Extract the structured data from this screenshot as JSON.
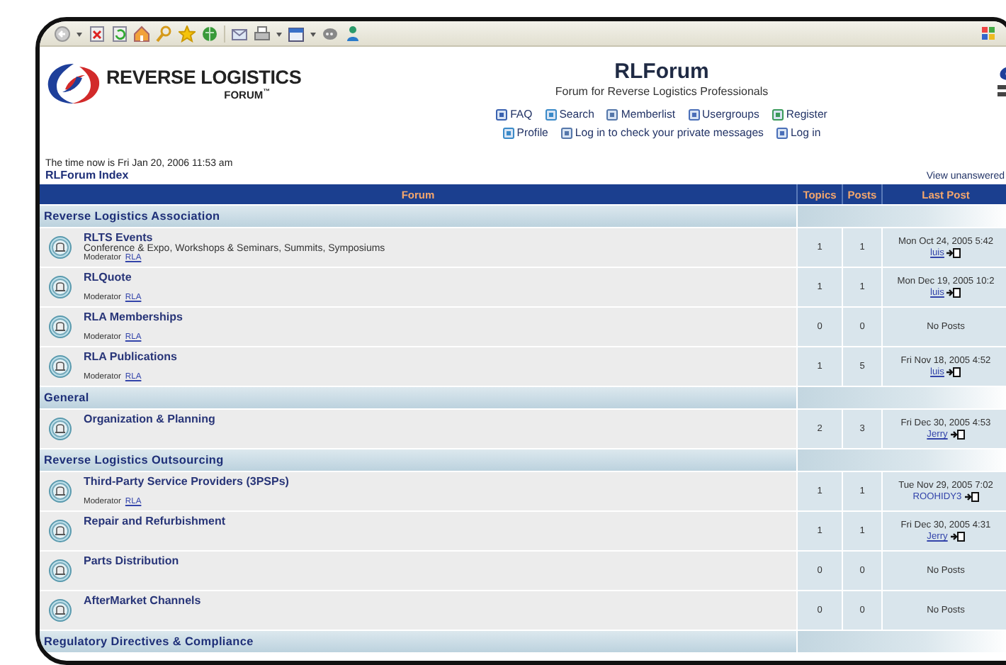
{
  "logo": {
    "line1": "REVERSE LOGISTICS",
    "line2": "FORUM$^{™}$"
  },
  "site": {
    "title": "RLForum",
    "subtitle": "Forum for Reverse Logistics Professionals"
  },
  "nav_rows": [
    [
      {
        "label": "FAQ"
      },
      {
        "label": "Search"
      },
      {
        "label": "Memberlist"
      },
      {
        "label": "Usergroups"
      },
      {
        "label": "Register"
      }
    ],
    [
      {
        "label": "Profile"
      },
      {
        "label": "Log in to check your private messages"
      },
      {
        "label": "Log in"
      }
    ]
  ],
  "time_text": "The time now is Fri Jan 20, 2006 11:53 am",
  "breadcrumb": "RLForum Index",
  "view_link": "View unanswered",
  "table": {
    "columns": [
      "Forum",
      "Topics",
      "Posts",
      "Last Post"
    ],
    "categories": [
      {
        "name": "Reverse Logistics Association",
        "forums": [
          {
            "name": "RLTS Events",
            "description": "Conference & Expo, Workshops & Seminars, Summits, Symposiums",
            "moderator_label": "Moderator",
            "moderator": "RLA",
            "topics": "1",
            "posts": "1",
            "last_post": {
              "date": "Mon Oct 24, 2005 5:42",
              "user": "luis",
              "linked": true
            }
          },
          {
            "name": "RLQuote",
            "moderator_label": "Moderator",
            "moderator": "RLA",
            "topics": "1",
            "posts": "1",
            "last_post": {
              "date": "Mon Dec 19, 2005 10:2",
              "user": "luis",
              "linked": true
            }
          },
          {
            "name": "RLA Memberships",
            "moderator_label": "Moderator",
            "moderator": "RLA",
            "topics": "0",
            "posts": "0",
            "last_post": {
              "text": "No Posts"
            }
          },
          {
            "name": "RLA Publications",
            "moderator_label": "Moderator",
            "moderator": "RLA",
            "topics": "1",
            "posts": "5",
            "last_post": {
              "date": "Fri Nov 18, 2005 4:52",
              "user": "luis",
              "linked": true
            }
          }
        ]
      },
      {
        "name": "General",
        "forums": [
          {
            "name": "Organization & Planning",
            "topics": "2",
            "posts": "3",
            "last_post": {
              "date": "Fri Dec 30, 2005 4:53",
              "user": "Jerry",
              "linked": true
            }
          }
        ]
      },
      {
        "name": "Reverse Logistics Outsourcing",
        "forums": [
          {
            "name": "Third-Party Service Providers (3PSPs)",
            "moderator_label": "Moderator",
            "moderator": "RLA",
            "topics": "1",
            "posts": "1",
            "last_post": {
              "date": "Tue Nov 29, 2005 7:02",
              "user": "ROOHIDY3",
              "linked": false
            }
          },
          {
            "name": "Repair and Refurbishment",
            "topics": "1",
            "posts": "1",
            "last_post": {
              "date": "Fri Dec 30, 2005 4:31",
              "user": "Jerry",
              "linked": true
            }
          },
          {
            "name": "Parts Distribution",
            "topics": "0",
            "posts": "0",
            "last_post": {
              "text": "No Posts"
            }
          },
          {
            "name": "AfterMarket Channels",
            "topics": "0",
            "posts": "0",
            "last_post": {
              "text": "No Posts"
            }
          }
        ]
      },
      {
        "name": "Regulatory Directives & Compliance"
      }
    ]
  }
}
